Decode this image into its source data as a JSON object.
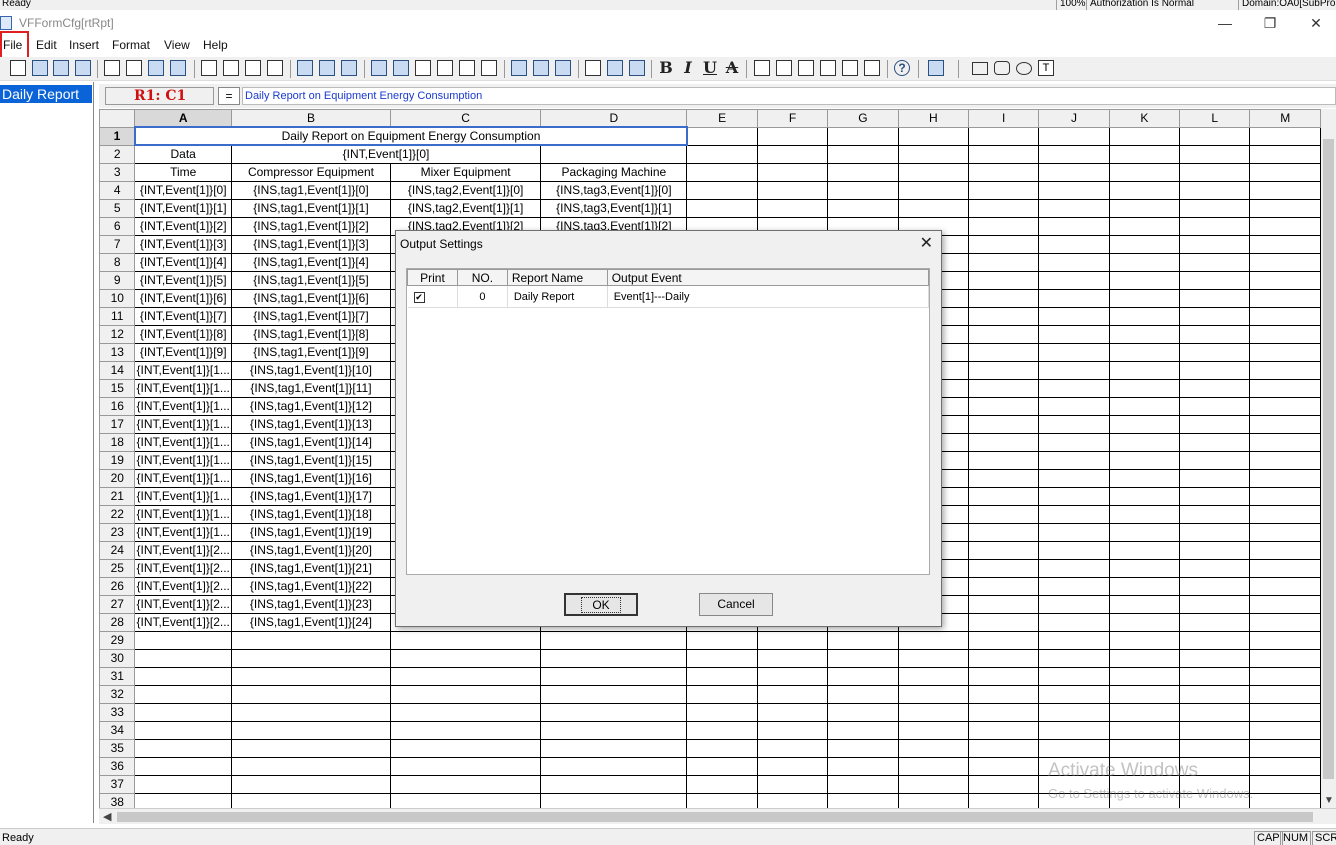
{
  "top_status": {
    "left": "Ready",
    "zoom": "100%",
    "auth": "Authorization Is Normal",
    "domain": "Domain:OA0[SubPro"
  },
  "window": {
    "title": "VFFormCfg[rtRpt]",
    "minimize": "—",
    "restore": "❐",
    "close": "✕"
  },
  "menu": [
    "File",
    "Edit",
    "Insert",
    "Format",
    "View",
    "Help"
  ],
  "left_panel": {
    "selected_item": "Daily Report"
  },
  "formula_bar": {
    "cell_ref": "R1: C1",
    "equals": "=",
    "value": "Daily Report on Equipment Energy Consumption"
  },
  "grid": {
    "columns": [
      "A",
      "B",
      "C",
      "D",
      "E",
      "F",
      "G",
      "H",
      "I",
      "J",
      "K",
      "L",
      "M"
    ],
    "row_numbers": [
      "1",
      "2",
      "3",
      "4",
      "5",
      "6",
      "7",
      "8",
      "9",
      "10",
      "11",
      "12",
      "13",
      "14",
      "15",
      "16",
      "17",
      "18",
      "19",
      "20",
      "21",
      "22",
      "23",
      "24",
      "25",
      "26",
      "27",
      "28",
      "29",
      "30",
      "31",
      "32",
      "33",
      "34",
      "35",
      "36",
      "37",
      "38"
    ],
    "row1_title": "Daily Report on Equipment Energy Consumption",
    "row2": {
      "a": "Data",
      "b": "{INT,Event[1]}[0]"
    },
    "row3": [
      "Time",
      "Compressor Equipment",
      "Mixer Equipment",
      "Packaging Machine"
    ],
    "data_rows": [
      [
        "{INT,Event[1]}[0]",
        "{INS,tag1,Event[1]}[0]",
        "{INS,tag2,Event[1]}[0]",
        "{INS,tag3,Event[1]}[0]"
      ],
      [
        "{INT,Event[1]}[1]",
        "{INS,tag1,Event[1]}[1]",
        "{INS,tag2,Event[1]}[1]",
        "{INS,tag3,Event[1]}[1]"
      ],
      [
        "{INT,Event[1]}[2]",
        "{INS,tag1,Event[1]}[2]",
        "{INS,tag2,Event[1]}[2]",
        "{INS,tag3,Event[1]}[2]"
      ],
      [
        "{INT,Event[1]}[3]",
        "{INS,tag1,Event[1]}[3]",
        "",
        ""
      ],
      [
        "{INT,Event[1]}[4]",
        "{INS,tag1,Event[1]}[4]",
        "",
        ""
      ],
      [
        "{INT,Event[1]}[5]",
        "{INS,tag1,Event[1]}[5]",
        "",
        ""
      ],
      [
        "{INT,Event[1]}[6]",
        "{INS,tag1,Event[1]}[6]",
        "",
        ""
      ],
      [
        "{INT,Event[1]}[7]",
        "{INS,tag1,Event[1]}[7]",
        "",
        ""
      ],
      [
        "{INT,Event[1]}[8]",
        "{INS,tag1,Event[1]}[8]",
        "",
        ""
      ],
      [
        "{INT,Event[1]}[9]",
        "{INS,tag1,Event[1]}[9]",
        "",
        ""
      ],
      [
        "{INT,Event[1]}[1...",
        "{INS,tag1,Event[1]}[10]",
        "",
        ""
      ],
      [
        "{INT,Event[1]}[1...",
        "{INS,tag1,Event[1]}[11]",
        "",
        ""
      ],
      [
        "{INT,Event[1]}[1...",
        "{INS,tag1,Event[1]}[12]",
        "",
        ""
      ],
      [
        "{INT,Event[1]}[1...",
        "{INS,tag1,Event[1]}[13]",
        "",
        ""
      ],
      [
        "{INT,Event[1]}[1...",
        "{INS,tag1,Event[1]}[14]",
        "",
        ""
      ],
      [
        "{INT,Event[1]}[1...",
        "{INS,tag1,Event[1]}[15]",
        "",
        ""
      ],
      [
        "{INT,Event[1]}[1...",
        "{INS,tag1,Event[1]}[16]",
        "",
        ""
      ],
      [
        "{INT,Event[1]}[1...",
        "{INS,tag1,Event[1]}[17]",
        "",
        ""
      ],
      [
        "{INT,Event[1]}[1...",
        "{INS,tag1,Event[1]}[18]",
        "",
        ""
      ],
      [
        "{INT,Event[1]}[1...",
        "{INS,tag1,Event[1]}[19]",
        "",
        ""
      ],
      [
        "{INT,Event[1]}[2...",
        "{INS,tag1,Event[1]}[20]",
        "",
        ""
      ],
      [
        "{INT,Event[1]}[2...",
        "{INS,tag1,Event[1]}[21]",
        "",
        ""
      ],
      [
        "{INT,Event[1]}[2...",
        "{INS,tag1,Event[1]}[22]",
        "",
        ""
      ],
      [
        "{INT,Event[1]}[2...",
        "{INS,tag1,Event[1]}[23]",
        "",
        ""
      ],
      [
        "{INT,Event[1]}[2...",
        "{INS,tag1,Event[1]}[24]",
        "",
        ""
      ]
    ]
  },
  "toolbar": {
    "bold": "B",
    "italic": "I",
    "underline": "U",
    "strike": "A",
    "help": "?",
    "text_tool": "T"
  },
  "dialog": {
    "title": "Output Settings",
    "close": "✕",
    "columns": [
      "Print",
      "NO.",
      "Report Name",
      "Output Event"
    ],
    "rows": [
      {
        "print": "✔",
        "no": "0",
        "report_name": "Daily Report",
        "output_event": "Event[1]---Daily"
      }
    ],
    "ok_label": "OK",
    "cancel_label": "Cancel"
  },
  "watermark": {
    "line1": "Activate Windows",
    "line2": "Go to Settings to activate Windows."
  },
  "status_bar": {
    "text": "Ready",
    "cap": "CAP",
    "num": "NUM",
    "scrl": "SCRL"
  }
}
